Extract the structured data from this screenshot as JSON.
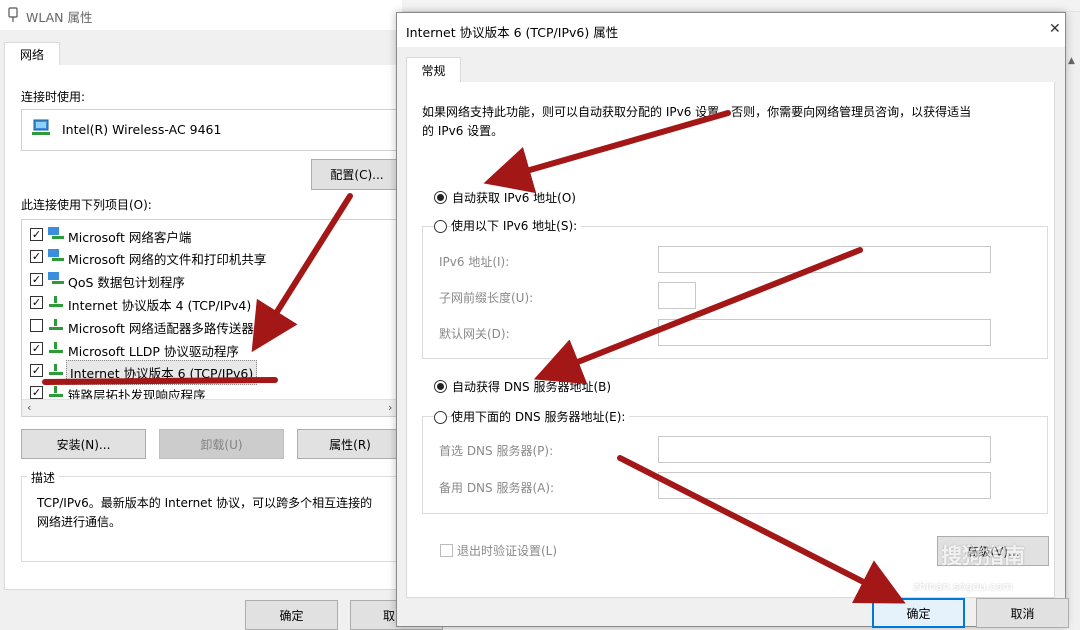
{
  "wlan": {
    "title": "WLAN 属性",
    "tab": "网络",
    "connect_using_label": "连接时使用:",
    "adapter_name": "Intel(R) Wireless-AC 9461",
    "configure_button": "配置(C)...",
    "items_label": "此连接使用下列项目(O):",
    "items": [
      {
        "label": "Microsoft 网络客户端",
        "checked": true,
        "icon": "network-client-icon"
      },
      {
        "label": "Microsoft 网络的文件和打印机共享",
        "checked": true,
        "icon": "file-sharing-icon"
      },
      {
        "label": "QoS 数据包计划程序",
        "checked": true,
        "icon": "qos-icon"
      },
      {
        "label": "Internet 协议版本 4 (TCP/IPv4)",
        "checked": true,
        "icon": "protocol-icon"
      },
      {
        "label": "Microsoft 网络适配器多路传送器协议",
        "checked": false,
        "icon": "protocol-icon"
      },
      {
        "label": "Microsoft LLDP 协议驱动程序",
        "checked": true,
        "icon": "protocol-icon"
      },
      {
        "label": "Internet 协议版本 6 (TCP/IPv6)",
        "checked": true,
        "icon": "protocol-icon"
      },
      {
        "label": "链路层拓扑发现响应程序",
        "checked": true,
        "icon": "protocol-icon"
      }
    ],
    "install_button": "安装(N)...",
    "uninstall_button": "卸载(U)",
    "properties_button": "属性(R)",
    "description_label": "描述",
    "description_text_1": "TCP/IPv6。最新版本的 Internet 协议，可以跨多个相互连接的",
    "description_text_2": "网络进行通信。",
    "ok_button": "确定",
    "cancel_button": "取"
  },
  "ipv6": {
    "title": "Internet 协议版本 6 (TCP/IPv6) 属性",
    "close_glyph": "✕",
    "tab": "常规",
    "intro_line_1": "如果网络支持此功能，则可以自动获取分配的 IPv6 设置。否则，你需要向网络管理员咨询，以获得适当",
    "intro_line_2": "的 IPv6 设置。",
    "auto_ip_label": "自动获取 IPv6 地址(O)",
    "manual_ip_label": "使用以下 IPv6 地址(S):",
    "ipv6_address_label": "IPv6 地址(I):",
    "prefix_length_label": "子网前缀长度(U):",
    "gateway_label": "默认网关(D):",
    "auto_dns_label": "自动获得 DNS 服务器地址(B)",
    "manual_dns_label": "使用下面的 DNS 服务器地址(E):",
    "preferred_dns_label": "首选 DNS 服务器(P):",
    "alternate_dns_label": "备用 DNS 服务器(A):",
    "validate_label": "退出时验证设置(L)",
    "advanced_button": "高级(V)...",
    "ok_button": "确定",
    "cancel_button": "取消"
  },
  "watermark": {
    "text": "搜狗指南",
    "url": "zhinan.sogou.com"
  },
  "colors": {
    "arrow": "#a31717",
    "accent": "#0078d7"
  }
}
